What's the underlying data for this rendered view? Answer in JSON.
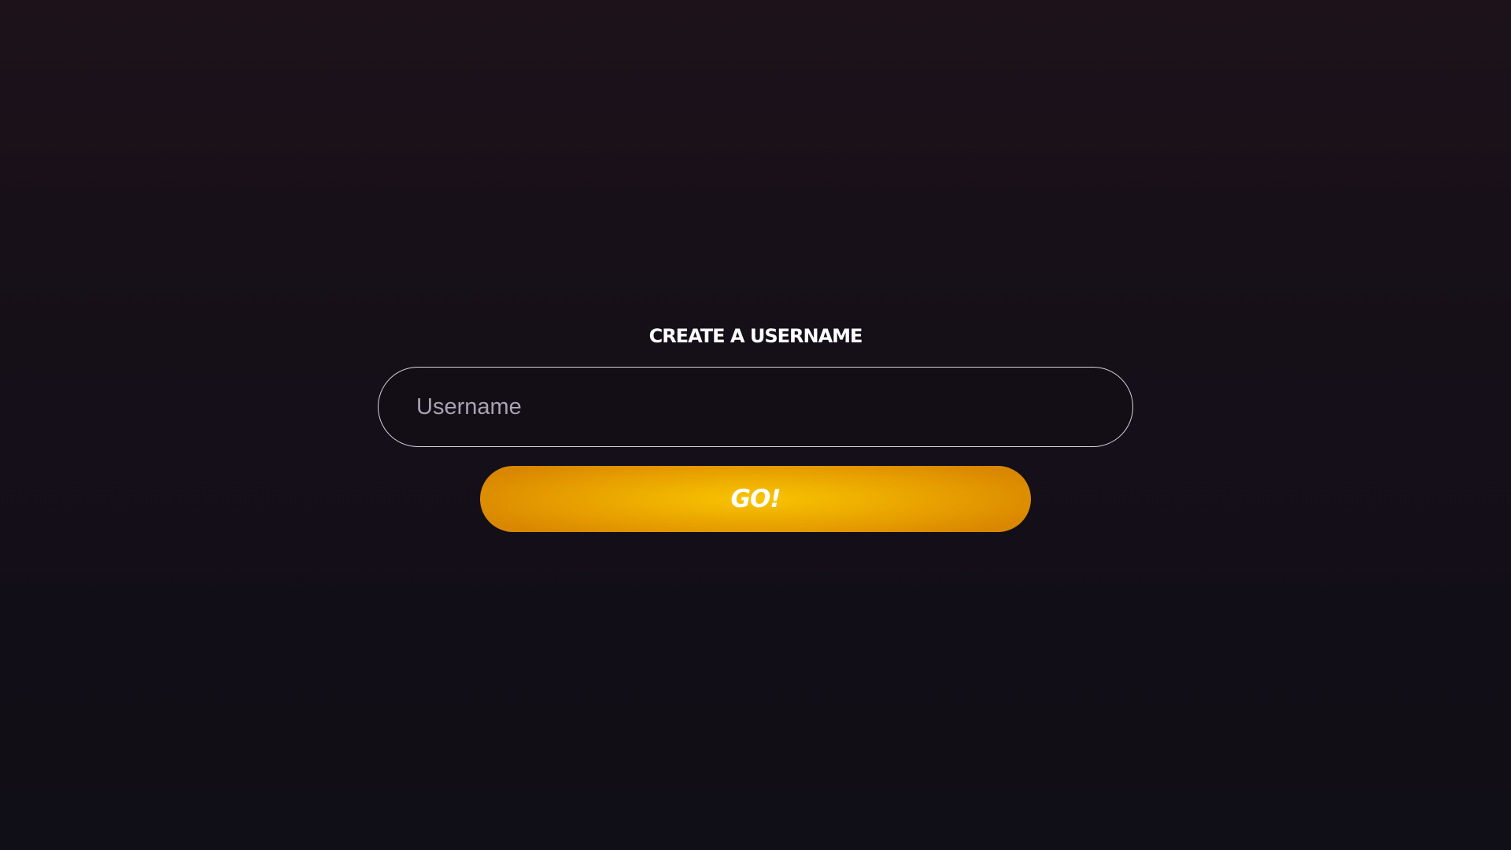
{
  "form": {
    "title": "CREATE A USERNAME",
    "username_input": {
      "value": "",
      "placeholder": "Username"
    },
    "submit_label": "GO!"
  },
  "colors": {
    "background_top": "#1d121a",
    "background_bottom": "#100e16",
    "input_border": "#d9d4dc",
    "placeholder": "#a8a2b4",
    "button_center": "#f8c400",
    "button_edge": "#d98700",
    "text": "#ffffff"
  }
}
